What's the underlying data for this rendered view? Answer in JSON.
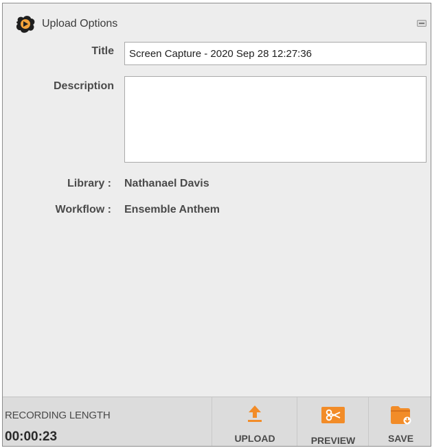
{
  "window": {
    "title": "Upload Options"
  },
  "form": {
    "title_label": "Title",
    "title_value": "Screen Capture - 2020 Sep 28 12:27:36",
    "description_label": "Description",
    "description_value": "",
    "library_label": "Library :",
    "library_value": "Nathanael Davis",
    "workflow_label": "Workflow :",
    "workflow_value": "Ensemble Anthem"
  },
  "footer": {
    "recording_length_label": "RECORDING LENGTH",
    "recording_length_value": "00:00:23",
    "actions": {
      "upload_label": "UPLOAD",
      "preview_label": "PREVIEW",
      "save_label": "SAVE"
    }
  },
  "colors": {
    "accent": "#f28c28",
    "panel_background": "#ededed",
    "footer_background": "#dcdcdc"
  },
  "icons": {
    "logo": "app-logo-icon",
    "upload": "upload-arrow-icon",
    "preview": "scissors-icon",
    "save": "folder-save-icon",
    "minimize": "minimize-icon"
  }
}
